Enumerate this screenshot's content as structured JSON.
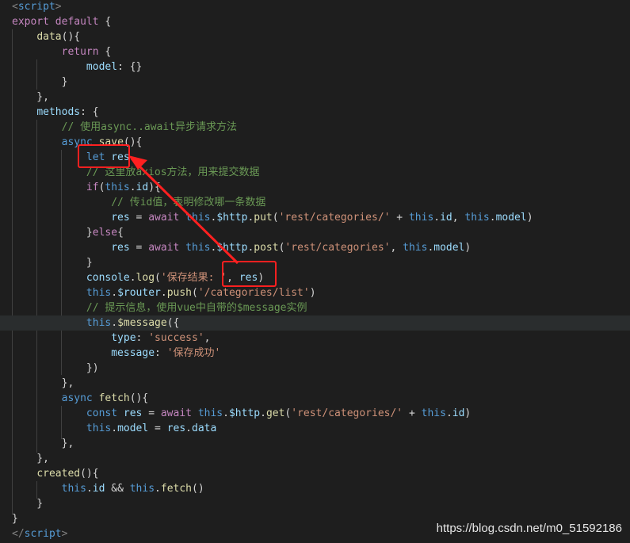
{
  "colors": {
    "background": "#1e1e1e",
    "keyword": "#569cd6",
    "control": "#c586c0",
    "function": "#dcdcaa",
    "variable": "#9cdcfe",
    "string": "#ce9178",
    "comment": "#6a9955",
    "annotation": "#ff2020"
  },
  "code_lines": [
    [
      [
        "tag",
        "<"
      ],
      [
        "tagname",
        "script"
      ],
      [
        "tag",
        ">"
      ]
    ],
    [
      [
        "ctrl",
        "export"
      ],
      [
        "plain",
        " "
      ],
      [
        "ctrl",
        "default"
      ],
      [
        "plain",
        " {"
      ]
    ],
    [
      [
        "plain",
        "    "
      ],
      [
        "fn",
        "data"
      ],
      [
        "plain",
        "(){"
      ]
    ],
    [
      [
        "plain",
        "        "
      ],
      [
        "ctrl",
        "return"
      ],
      [
        "plain",
        " {"
      ]
    ],
    [
      [
        "plain",
        "            "
      ],
      [
        "var",
        "model"
      ],
      [
        "plain",
        ": {}"
      ]
    ],
    [
      [
        "plain",
        "        }"
      ]
    ],
    [
      [
        "plain",
        "    },"
      ]
    ],
    [
      [
        "plain",
        "    "
      ],
      [
        "var",
        "methods"
      ],
      [
        "plain",
        ": {"
      ]
    ],
    [
      [
        "plain",
        "        "
      ],
      [
        "cmt",
        "// 使用async..await异步请求方法"
      ]
    ],
    [
      [
        "plain",
        "        "
      ],
      [
        "kw",
        "async"
      ],
      [
        "plain",
        " "
      ],
      [
        "fn",
        "save"
      ],
      [
        "plain",
        "(){"
      ]
    ],
    [
      [
        "plain",
        "            "
      ],
      [
        "kw",
        "let"
      ],
      [
        "plain",
        " "
      ],
      [
        "var",
        "res"
      ]
    ],
    [
      [
        "plain",
        "            "
      ],
      [
        "cmt",
        "// 这里放axios方法，用来提交数据"
      ]
    ],
    [
      [
        "plain",
        "            "
      ],
      [
        "ctrl",
        "if"
      ],
      [
        "plain",
        "("
      ],
      [
        "this",
        "this"
      ],
      [
        "plain",
        "."
      ],
      [
        "var",
        "id"
      ],
      [
        "plain",
        "){"
      ]
    ],
    [
      [
        "plain",
        "                "
      ],
      [
        "cmt",
        "// 传id值，表明修改哪一条数据"
      ]
    ],
    [
      [
        "plain",
        "                "
      ],
      [
        "var",
        "res"
      ],
      [
        "plain",
        " = "
      ],
      [
        "ctrl",
        "await"
      ],
      [
        "plain",
        " "
      ],
      [
        "this",
        "this"
      ],
      [
        "plain",
        "."
      ],
      [
        "var",
        "$http"
      ],
      [
        "plain",
        "."
      ],
      [
        "fn",
        "put"
      ],
      [
        "plain",
        "("
      ],
      [
        "str",
        "'rest/categories/'"
      ],
      [
        "plain",
        " + "
      ],
      [
        "this",
        "this"
      ],
      [
        "plain",
        "."
      ],
      [
        "var",
        "id"
      ],
      [
        "plain",
        ", "
      ],
      [
        "this",
        "this"
      ],
      [
        "plain",
        "."
      ],
      [
        "var",
        "model"
      ],
      [
        "plain",
        ")"
      ]
    ],
    [
      [
        "plain",
        "            }"
      ],
      [
        "ctrl",
        "else"
      ],
      [
        "plain",
        "{"
      ]
    ],
    [
      [
        "plain",
        "                "
      ],
      [
        "var",
        "res"
      ],
      [
        "plain",
        " = "
      ],
      [
        "ctrl",
        "await"
      ],
      [
        "plain",
        " "
      ],
      [
        "this",
        "this"
      ],
      [
        "plain",
        "."
      ],
      [
        "var",
        "$http"
      ],
      [
        "plain",
        "."
      ],
      [
        "fn",
        "post"
      ],
      [
        "plain",
        "("
      ],
      [
        "str",
        "'rest/categories'"
      ],
      [
        "plain",
        ", "
      ],
      [
        "this",
        "this"
      ],
      [
        "plain",
        "."
      ],
      [
        "var",
        "model"
      ],
      [
        "plain",
        ")"
      ]
    ],
    [
      [
        "plain",
        "            }"
      ]
    ],
    [
      [
        "plain",
        "            "
      ],
      [
        "var",
        "console"
      ],
      [
        "plain",
        "."
      ],
      [
        "fn",
        "log"
      ],
      [
        "plain",
        "("
      ],
      [
        "str",
        "'保存结果: '"
      ],
      [
        "plain",
        ", "
      ],
      [
        "var",
        "res"
      ],
      [
        "plain",
        ")"
      ]
    ],
    [
      [
        "plain",
        "            "
      ],
      [
        "this",
        "this"
      ],
      [
        "plain",
        "."
      ],
      [
        "var",
        "$router"
      ],
      [
        "plain",
        "."
      ],
      [
        "fn",
        "push"
      ],
      [
        "plain",
        "("
      ],
      [
        "str",
        "'/categories/list'"
      ],
      [
        "plain",
        ")"
      ]
    ],
    [
      [
        "plain",
        "            "
      ],
      [
        "cmt",
        "// 提示信息，使用vue中自带的$message实例"
      ]
    ],
    [
      [
        "plain",
        "            "
      ],
      [
        "this",
        "this"
      ],
      [
        "plain",
        "."
      ],
      [
        "fn",
        "$message"
      ],
      [
        "plain",
        "({"
      ]
    ],
    [
      [
        "plain",
        "                "
      ],
      [
        "var",
        "type"
      ],
      [
        "plain",
        ": "
      ],
      [
        "str",
        "'success'"
      ],
      [
        "plain",
        ","
      ]
    ],
    [
      [
        "plain",
        "                "
      ],
      [
        "var",
        "message"
      ],
      [
        "plain",
        ": "
      ],
      [
        "str",
        "'保存成功'"
      ]
    ],
    [
      [
        "plain",
        "            })"
      ]
    ],
    [
      [
        "plain",
        "        },"
      ]
    ],
    [
      [
        "plain",
        "        "
      ],
      [
        "kw",
        "async"
      ],
      [
        "plain",
        " "
      ],
      [
        "fn",
        "fetch"
      ],
      [
        "plain",
        "(){"
      ]
    ],
    [
      [
        "plain",
        "            "
      ],
      [
        "kw",
        "const"
      ],
      [
        "plain",
        " "
      ],
      [
        "var",
        "res"
      ],
      [
        "plain",
        " = "
      ],
      [
        "ctrl",
        "await"
      ],
      [
        "plain",
        " "
      ],
      [
        "this",
        "this"
      ],
      [
        "plain",
        "."
      ],
      [
        "var",
        "$http"
      ],
      [
        "plain",
        "."
      ],
      [
        "fn",
        "get"
      ],
      [
        "plain",
        "("
      ],
      [
        "str",
        "'rest/categories/'"
      ],
      [
        "plain",
        " + "
      ],
      [
        "this",
        "this"
      ],
      [
        "plain",
        "."
      ],
      [
        "var",
        "id"
      ],
      [
        "plain",
        ")"
      ]
    ],
    [
      [
        "plain",
        "            "
      ],
      [
        "this",
        "this"
      ],
      [
        "plain",
        "."
      ],
      [
        "var",
        "model"
      ],
      [
        "plain",
        " = "
      ],
      [
        "var",
        "res"
      ],
      [
        "plain",
        "."
      ],
      [
        "var",
        "data"
      ]
    ],
    [
      [
        "plain",
        "        },"
      ]
    ],
    [
      [
        "plain",
        "    },"
      ]
    ],
    [
      [
        "plain",
        "    "
      ],
      [
        "fn",
        "created"
      ],
      [
        "plain",
        "(){"
      ]
    ],
    [
      [
        "plain",
        "        "
      ],
      [
        "this",
        "this"
      ],
      [
        "plain",
        "."
      ],
      [
        "var",
        "id"
      ],
      [
        "plain",
        " && "
      ],
      [
        "this",
        "this"
      ],
      [
        "plain",
        "."
      ],
      [
        "fn",
        "fetch"
      ],
      [
        "plain",
        "()"
      ]
    ],
    [
      [
        "plain",
        "    }"
      ]
    ],
    [
      [
        "plain",
        "}"
      ]
    ],
    [
      [
        "tag",
        "</"
      ],
      [
        "tagname",
        "script"
      ],
      [
        "tag",
        ">"
      ]
    ]
  ],
  "watermark": "https://blog.csdn.net/m0_51592186"
}
